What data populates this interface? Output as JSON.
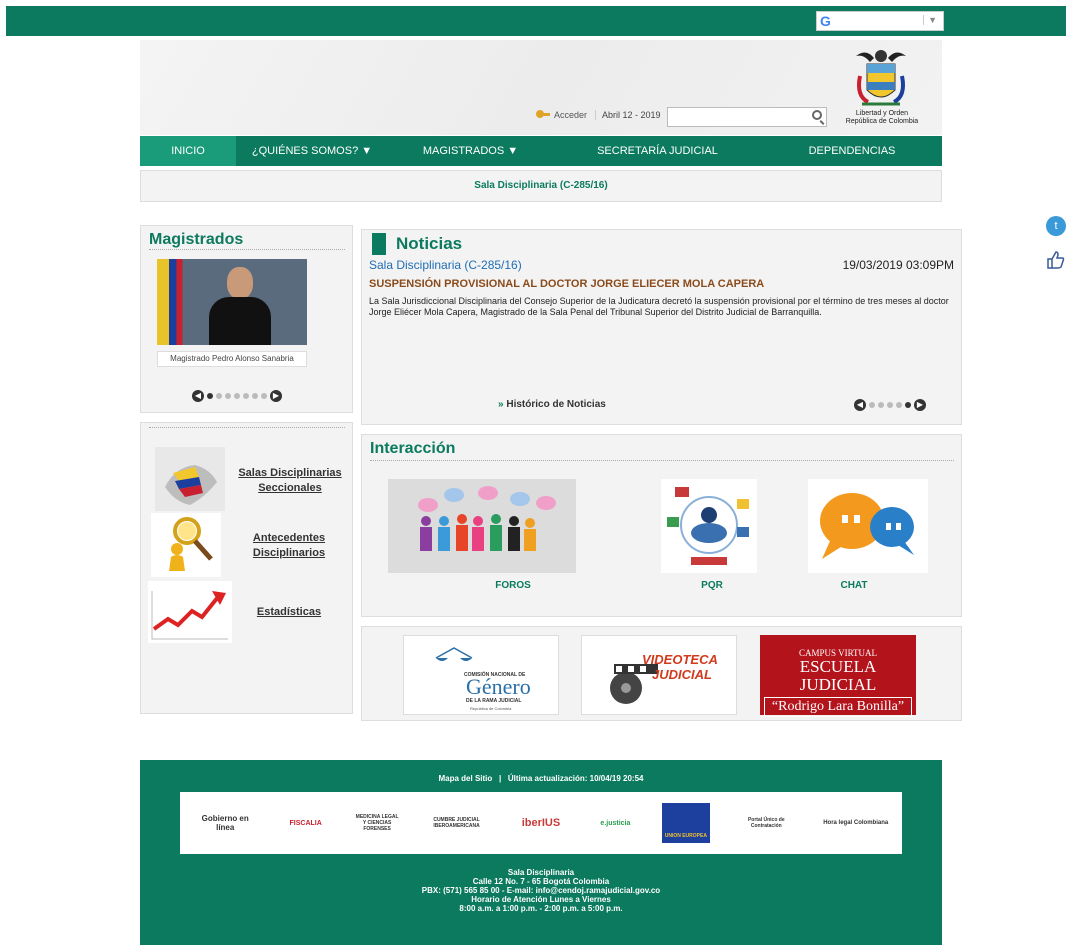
{
  "header": {
    "translate_label": "G",
    "translate_arrow": "▼",
    "login_label": "Acceder",
    "date": "Abril 12 - 2019",
    "search_placeholder": "",
    "crest_text_1": "Libertad y Orden",
    "crest_text_2": "República de Colombia"
  },
  "nav": {
    "items": [
      {
        "label": "INICIO"
      },
      {
        "label": "¿QUIÉNES SOMOS? ▼"
      },
      {
        "label": "MAGISTRADOS ▼"
      },
      {
        "label": "SECRETARÍA JUDICIAL"
      },
      {
        "label": "DEPENDENCIAS"
      }
    ]
  },
  "sala_bar": "Sala Disciplinaria (C-285/16)",
  "magistrados": {
    "title": "Magistrados",
    "caption": "Magistrado Pedro Alonso Sanabria"
  },
  "links": {
    "item1": "Salas Disciplinarias Seccionales",
    "item2": "Antecedentes Disciplinarios",
    "item3": "Estadísticas"
  },
  "noticias": {
    "title": "Noticias",
    "category": "Sala Disciplinaria (C-285/16)",
    "timestamp": "19/03/2019 03:09PM",
    "headline": "SUSPENSIÓN PROVISIONAL AL DOCTOR JORGE ELIECER MOLA CAPERA",
    "body": "La Sala Jurisdiccional Disciplinaria del Consejo Superior de la Judicatura decretó la suspensión provisional por el término de tres meses al doctor Jorge Eliécer Mola Capera, Magistrado de la Sala Penal del Tribunal Superior del Distrito Judicial de Barranquilla.",
    "history_link": "Histórico de Noticias"
  },
  "interaccion": {
    "title": "Interacción",
    "foros": "FOROS",
    "pqr": "PQR",
    "chat": "CHAT"
  },
  "banners": {
    "genero_line1": "COMISIÓN NACIONAL DE",
    "genero_line2": "Género",
    "genero_line3": "DE LA RAMA JUDICIAL",
    "genero_line4": "República de Colombia",
    "videoteca_line1": "VIDEOTECA",
    "videoteca_line2": "JUDICIAL",
    "campus_line1": "CAMPUS VIRTUAL",
    "campus_line2": "ESCUELA JUDICIAL",
    "campus_line3": "“Rodrigo Lara Bonilla”"
  },
  "footer": {
    "top_links": "Mapa del Sitio   |   Última actualización: 10/04/19 20:54",
    "logos": [
      "Gobierno en línea",
      "FISCALIA",
      "MEDICINA LEGAL Y CIENCIAS FORENSES",
      "CUMBRE JUDICIAL IBEROAMERICANA",
      "iberIUS",
      "e.justicia",
      "UNION EUROPEA",
      "Portal Único de Contratación",
      "Hora legal Colombiana"
    ],
    "address_title": "Sala Disciplinaria",
    "address": "Calle 12 No. 7 - 65 Bogotá Colombia",
    "contact": "PBX: (571) 565 85 00 - E-mail: info@cendoj.ramajudicial.gov.co",
    "hours_title": "Horario de Atención Lunes a Viernes",
    "hours": "8:00 a.m.  a 1:00 p.m. - 2:00 p.m. a 5:00 p.m."
  },
  "colors": {
    "primary_green": "#0b7a5e",
    "active_nav": "#1a9c7b",
    "headline": "#8a4b1c",
    "link_blue": "#1f6db5"
  }
}
